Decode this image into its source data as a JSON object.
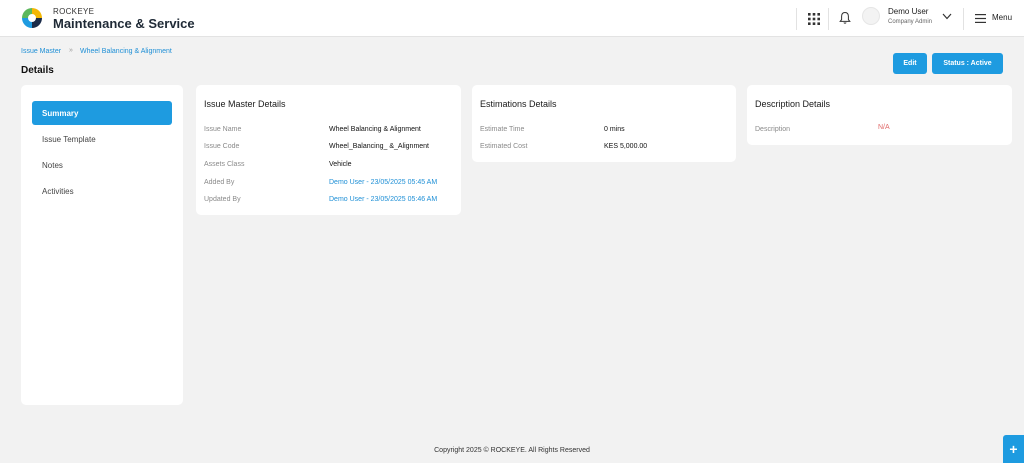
{
  "header": {
    "brand_small": "ROCKEYE",
    "brand_title": "Maintenance & Service",
    "user_name": "Demo User",
    "user_role": "Company Admin",
    "menu_label": "Menu"
  },
  "breadcrumb": {
    "parent": "Issue Master",
    "separator": "»",
    "current": "Wheel Balancing & Alignment"
  },
  "page": {
    "title": "Details",
    "edit_label": "Edit",
    "status_label": "Status : Active"
  },
  "sidebar": {
    "items": [
      {
        "label": "Summary",
        "active": true
      },
      {
        "label": "Issue Template",
        "active": false
      },
      {
        "label": "Notes",
        "active": false
      },
      {
        "label": "Activities",
        "active": false
      }
    ]
  },
  "issue_master": {
    "title": "Issue Master Details",
    "rows": [
      {
        "label": "Issue Name",
        "value": "Wheel Balancing & Alignment"
      },
      {
        "label": "Issue Code",
        "value": "Wheel_Balancing_ &_Alignment"
      },
      {
        "label": "Assets Class",
        "value": "Vehicle"
      },
      {
        "label": "Added By",
        "value": "Demo User - 23/05/2025 05:45 AM"
      },
      {
        "label": "Updated By",
        "value": "Demo User - 23/05/2025 05:46 AM"
      }
    ]
  },
  "estimations": {
    "title": "Estimations Details",
    "rows": [
      {
        "label": "Estimate Time",
        "value": "0 mins"
      },
      {
        "label": "Estimated Cost",
        "value": "KES 5,000.00"
      }
    ]
  },
  "description": {
    "title": "Description Details",
    "rows": [
      {
        "label": "Description",
        "value": "N/A"
      }
    ]
  },
  "footer": {
    "copyright": "Copyright 2025 © ROCKEYE. All Rights Reserved"
  },
  "fab": {
    "label": "+"
  },
  "colors": {
    "accent": "#1e9be0",
    "link": "#1e8fd6",
    "na": "#e06a6a",
    "background": "#f2f2f2"
  }
}
